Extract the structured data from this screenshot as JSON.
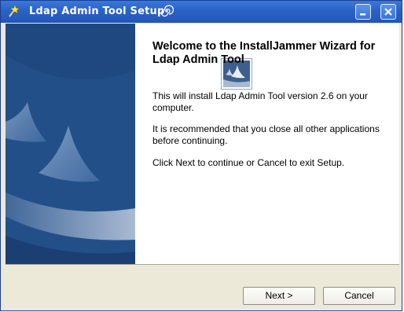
{
  "window": {
    "title": "Ldap Admin Tool Setup",
    "icons": [
      "wand-icon",
      "swirl-icon",
      "minimize-icon",
      "close-icon"
    ]
  },
  "content": {
    "heading": "Welcome to the InstallJammer Wizard for Ldap Admin Tool",
    "paragraph1": "This will install Ldap Admin Tool version 2.6 on your computer.",
    "paragraph2": "It is recommended that you close all other applications before  continuing.",
    "paragraph3": "Click Next to continue or Cancel to exit Setup."
  },
  "buttons": {
    "next": "Next >",
    "cancel": "Cancel"
  },
  "colors": {
    "titlebar": "#2a62c6",
    "sidebar": "#2d5c93",
    "dialog_bg": "#ece9d8"
  }
}
